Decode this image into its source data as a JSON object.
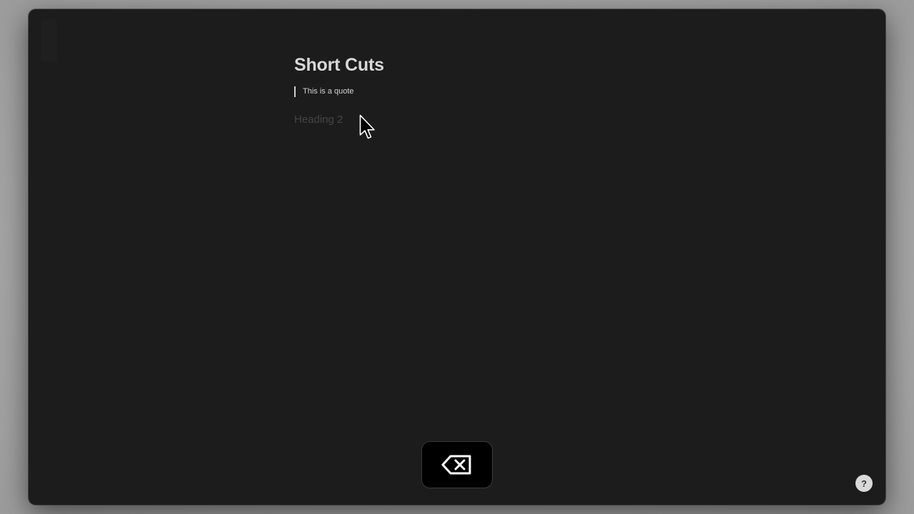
{
  "document": {
    "title": "Short Cuts",
    "quote": "This is a quote",
    "heading2_placeholder": "Heading 2"
  },
  "key_overlay": {
    "icon": "backspace-icon"
  },
  "help_button": {
    "label": "?",
    "icon": "help-icon"
  },
  "colors": {
    "window_bg": "#1c1c1c",
    "text_primary": "#d8d8d8",
    "placeholder": "#454545",
    "desktop": "#a6a6a6"
  }
}
